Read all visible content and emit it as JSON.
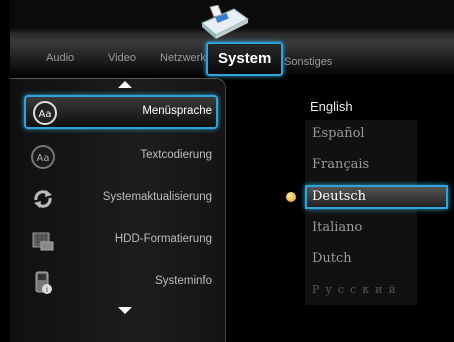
{
  "tabs": [
    {
      "label": "Audio",
      "selected": false
    },
    {
      "label": "Video",
      "selected": false
    },
    {
      "label": "Netzwerk",
      "selected": false
    },
    {
      "label": "System",
      "selected": true
    },
    {
      "label": "Sonstiges",
      "selected": false
    }
  ],
  "menu": [
    {
      "label": "Menüsprache",
      "icon": "language-aa-icon",
      "selected": true
    },
    {
      "label": "Textcodierung",
      "icon": "text-encoding-aa-icon",
      "selected": false
    },
    {
      "label": "Systemaktualisierung",
      "icon": "refresh-arrows-icon",
      "selected": false
    },
    {
      "label": "HDD-Formatierung",
      "icon": "hdd-format-icon",
      "selected": false
    },
    {
      "label": "Systeminfo",
      "icon": "system-info-icon",
      "selected": false
    }
  ],
  "language": {
    "current": "English",
    "options": [
      {
        "label": "Español",
        "selected": false
      },
      {
        "label": "Français",
        "selected": false
      },
      {
        "label": "Deutsch",
        "selected": true
      },
      {
        "label": "Italiano",
        "selected": false
      },
      {
        "label": "Dutch",
        "selected": false
      },
      {
        "label": "Русский",
        "selected": false
      }
    ]
  },
  "colors": {
    "accent": "#2ea4d8",
    "bullet": "#e0a020"
  }
}
